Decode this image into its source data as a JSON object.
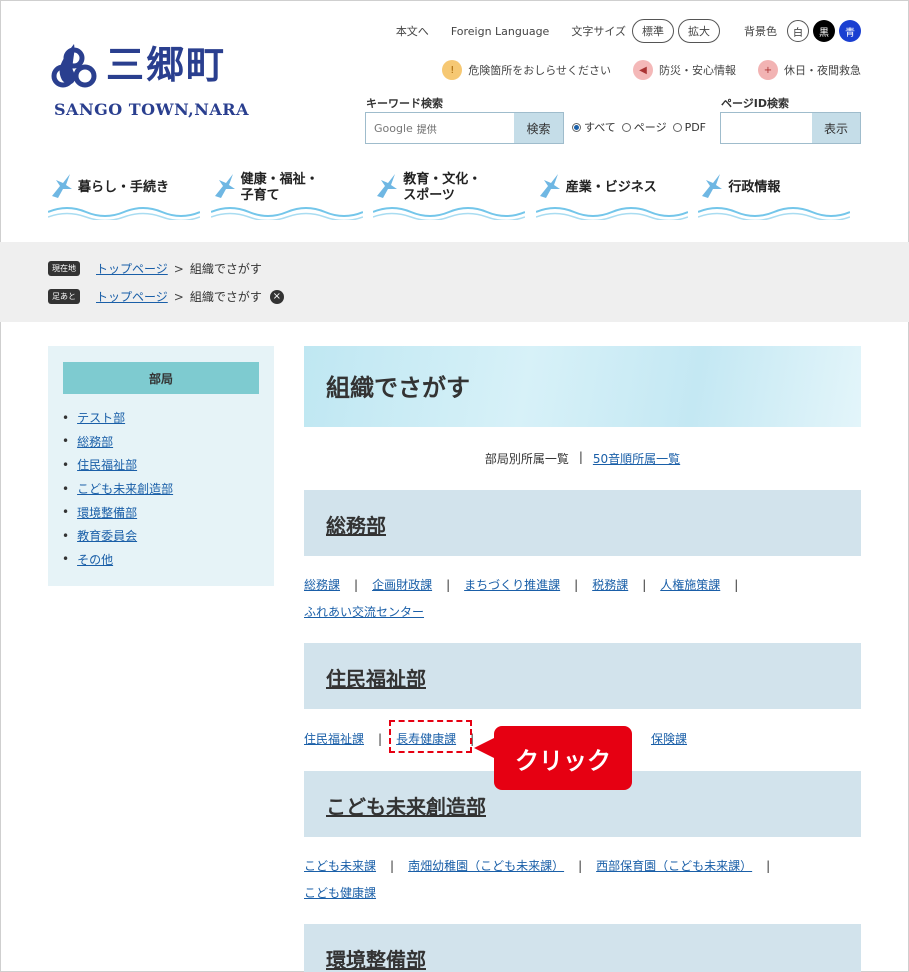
{
  "header": {
    "logo_name": "三郷町",
    "logo_sub": "SANGO TOWN,NARA",
    "util": {
      "to_content": "本文へ",
      "foreign_language": "Foreign Language",
      "font_size_label": "文字サイズ",
      "font_standard": "標準",
      "font_large": "拡大",
      "bg_label": "背景色",
      "bg_white": "白",
      "bg_black": "黒",
      "bg_blue": "青"
    },
    "notices": [
      {
        "label": "危険箇所をおしらせください",
        "icon": "warning-icon"
      },
      {
        "label": "防災・安心情報",
        "icon": "megaphone-icon"
      },
      {
        "label": "休日・夜間救急",
        "icon": "medical-icon"
      }
    ],
    "keyword_search": {
      "label": "キーワード検索",
      "placeholder_brand": "Google",
      "placeholder_suffix": "提供",
      "button": "検索",
      "options": [
        "すべて",
        "ページ",
        "PDF"
      ],
      "selected": "すべて"
    },
    "page_id_search": {
      "label": "ページID検索",
      "button": "表示"
    }
  },
  "nav": [
    {
      "label": "暮らし・手続き"
    },
    {
      "label": "健康・福祉・\n子育て"
    },
    {
      "label": "教育・文化・\nスポーツ"
    },
    {
      "label": "産業・ビジネス"
    },
    {
      "label": "行政情報"
    }
  ],
  "breadcrumbs": {
    "current_tag": "現在地",
    "history_tag": "足あと",
    "home": "トップページ",
    "separator": ">",
    "current": "組織でさがす"
  },
  "sidebar": {
    "heading": "部局",
    "items": [
      "テスト部",
      "総務部",
      "住民福祉部",
      "こども未来創造部",
      "環境整備部",
      "教育委員会",
      "その他"
    ]
  },
  "main": {
    "title": "組織でさがす",
    "tabs": {
      "current": "部局別所属一覧",
      "separator": "|",
      "other": "50音順所属一覧"
    },
    "sections": [
      {
        "title": "総務部",
        "links": [
          "総務課",
          "企画財政課",
          "まちづくり推進課",
          "税務課",
          "人権施策課",
          "ふれあい交流センター"
        ]
      },
      {
        "title": "住民福祉部",
        "links": [
          "住民福祉課",
          "長寿健康課",
          "保険課"
        ]
      },
      {
        "title": "こども未来創造部",
        "links": [
          "こども未来課",
          "南畑幼稚園（こども未来課）",
          "西部保育園（こども未来課）",
          "こども健康課"
        ]
      },
      {
        "title": "環境整備部",
        "links": []
      }
    ]
  },
  "callout": {
    "label": "クリック"
  },
  "colors": {
    "accent": "#e60012",
    "brand": "#2a3f8f",
    "link": "#1a5fa8",
    "section_bg": "#d2e3ec",
    "sidebar_head": "#7ecbd0"
  }
}
